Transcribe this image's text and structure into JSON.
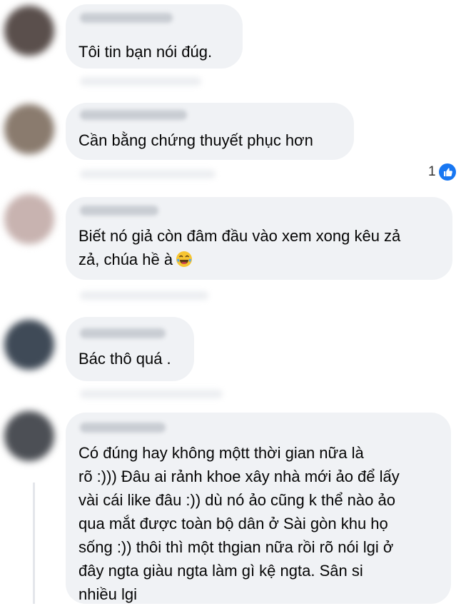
{
  "comments": [
    {
      "text": "Tôi tin bạn nói đúg."
    },
    {
      "text": "Cần bằng chứng thuyết phục hơn",
      "reaction": {
        "count": "1",
        "icon": "like-icon"
      }
    },
    {
      "text": "Biết nó giả còn đâm đầu vào xem xong kêu zả\nzả, chúa hề à",
      "emoji": "laughing-tears-emoji"
    },
    {
      "text": "Bác thô quá ."
    },
    {
      "text": "Có đúng hay không mộtt thời gian nữa là\nrõ :))) Đâu ai rảnh khoe xây nhà mới ảo để lấy\nvài cái like đâu :)) dù nó ảo cũng k thể nào ảo\nqua mắt được toàn bộ dân ở Sài gòn khu họ\nsống :)) thôi thì một thgian nữa rồi rõ nói lgi ở\nđây ngta giàu ngta làm gì kệ ngta. Sân si\nnhiều lgi"
    }
  ],
  "colors": {
    "bubble": "#f0f2f5",
    "like": "#1877f2",
    "text": "#050505"
  }
}
